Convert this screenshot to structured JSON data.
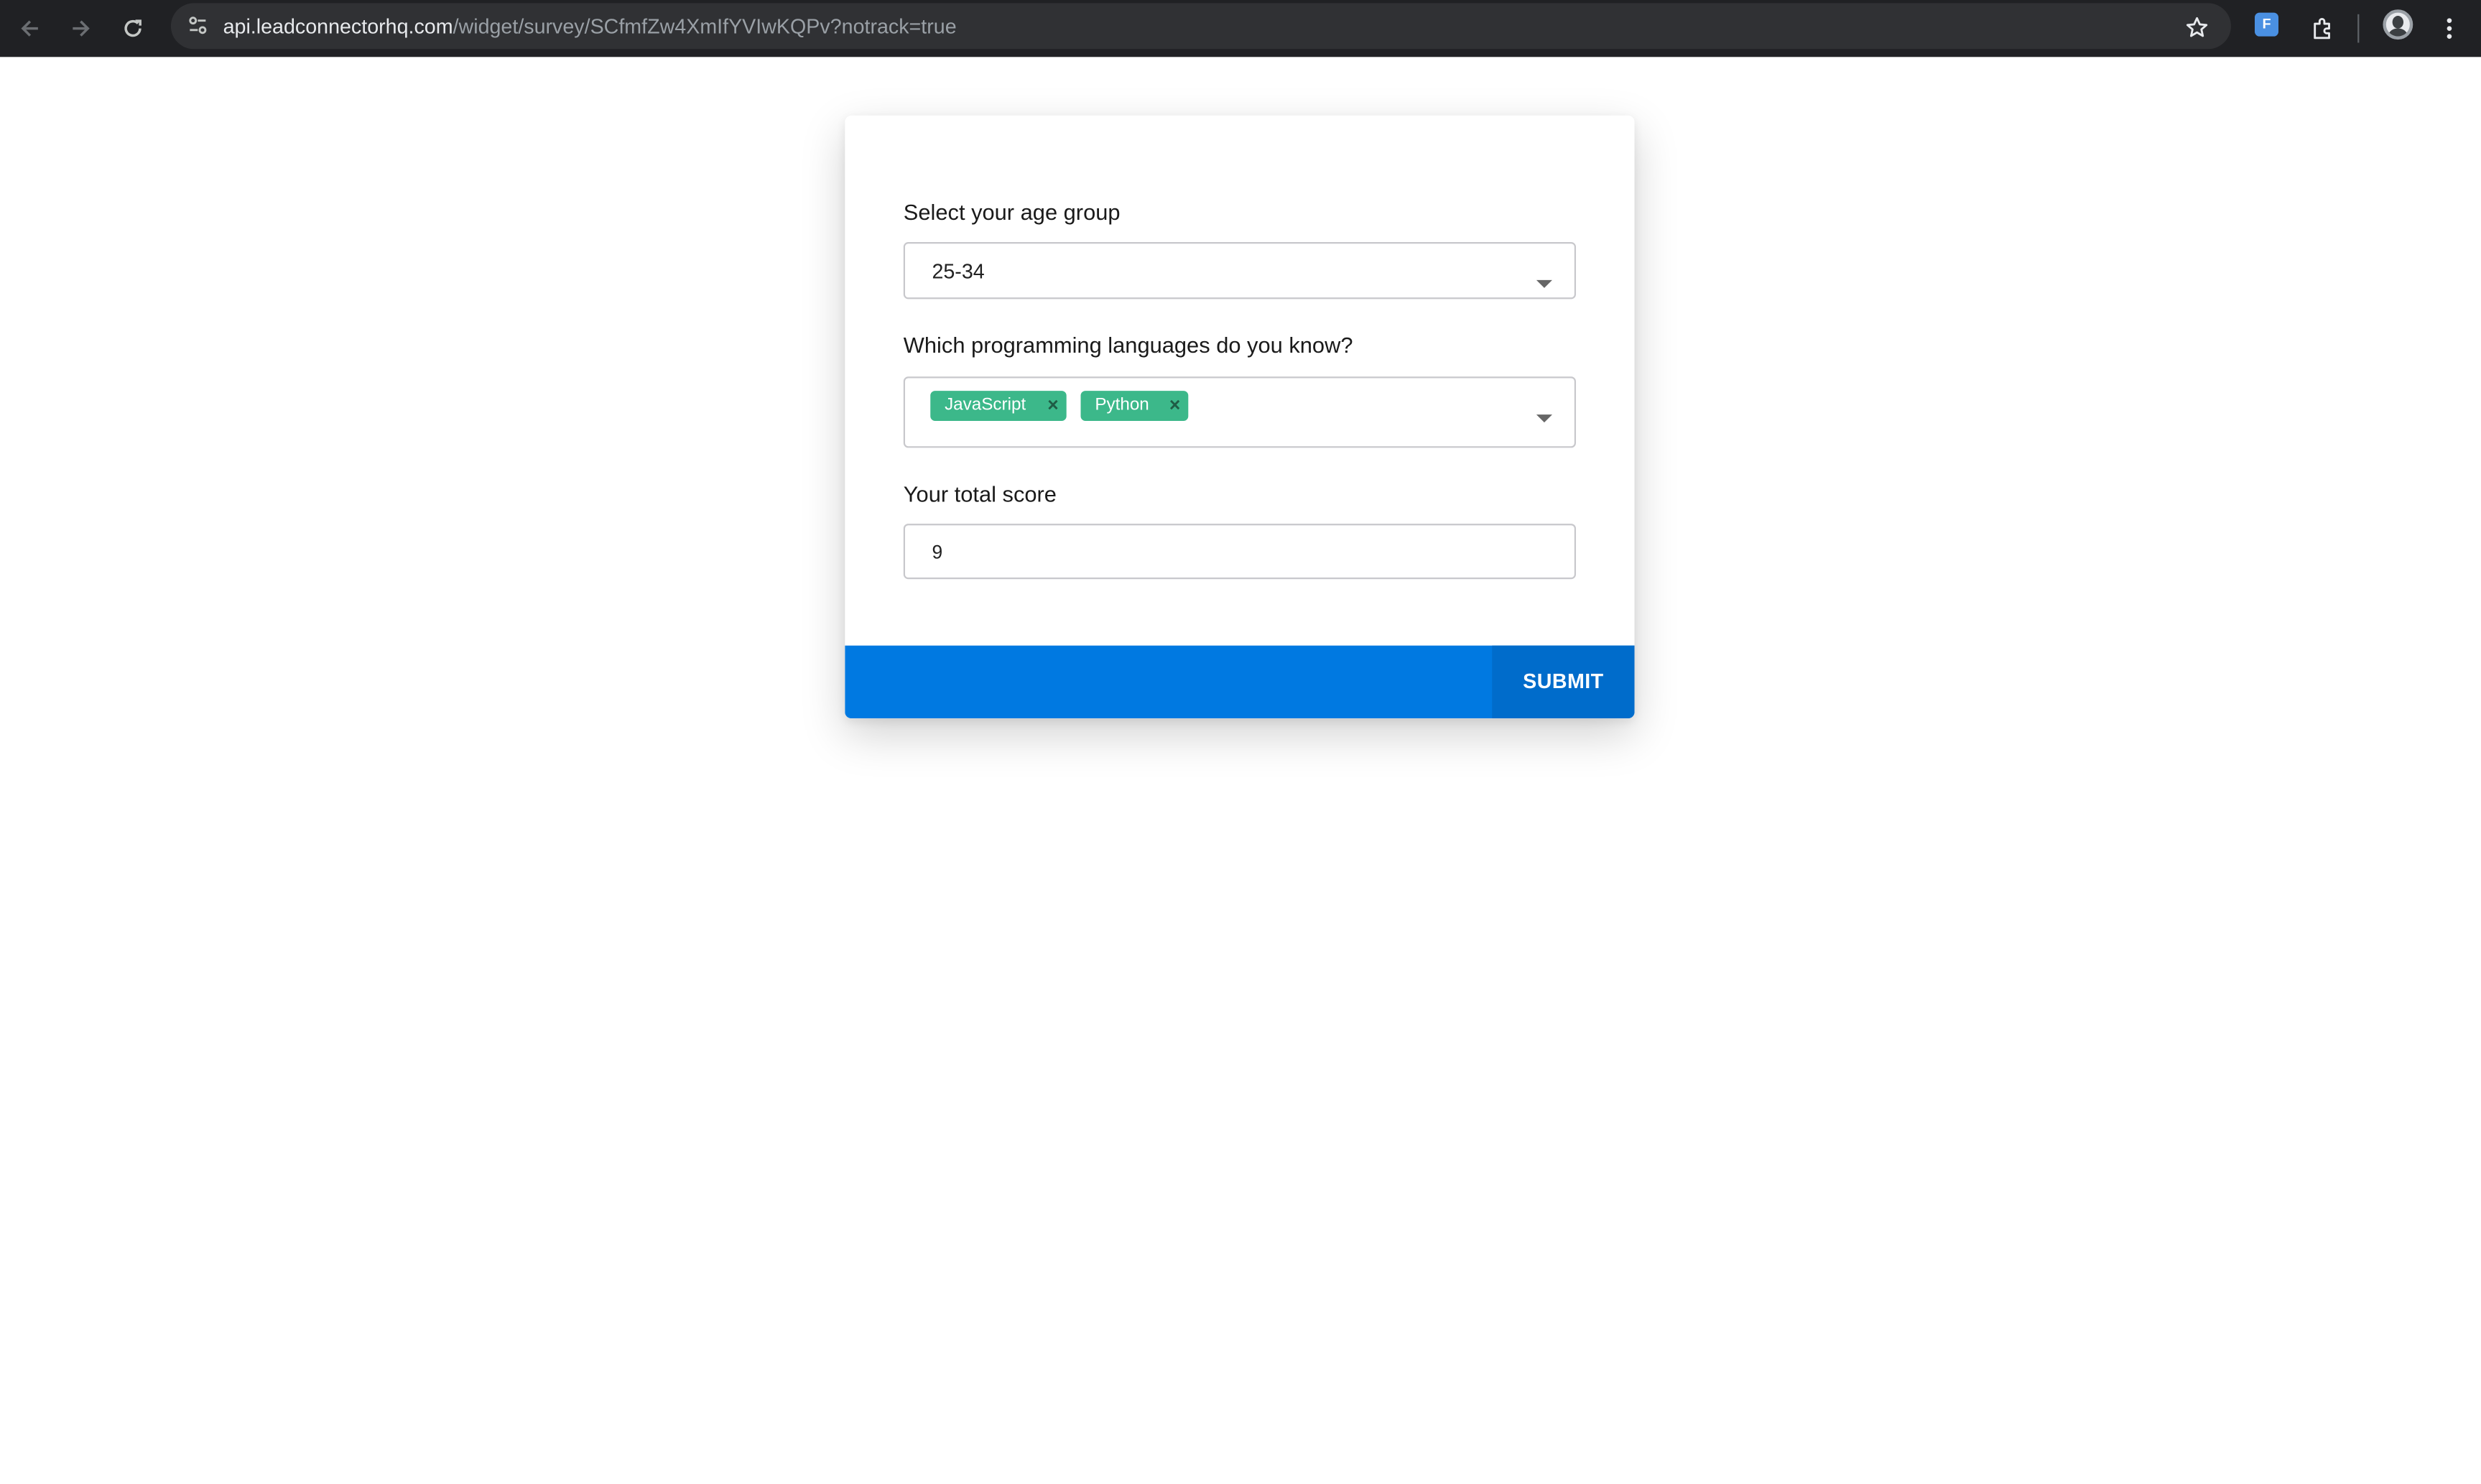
{
  "browser": {
    "url_host": "api.leadconnectorhq.com",
    "url_path": "/widget/survey/SCfmfZw4XmIfYVIwKQPv?notrack=true",
    "extension_badge": "F"
  },
  "survey": {
    "age_group": {
      "label": "Select your age group",
      "selected": "25-34"
    },
    "languages": {
      "label": "Which programming languages do you know?",
      "tags": [
        "JavaScript",
        "Python"
      ],
      "remove_glyph": "×"
    },
    "score": {
      "label": "Your total score",
      "value": "9"
    },
    "submit_label": "SUBMIT"
  },
  "colors": {
    "accent": "#0079e1",
    "submit": "#006ccb",
    "tag": "#3cb88a",
    "toolbar": "#202124"
  }
}
